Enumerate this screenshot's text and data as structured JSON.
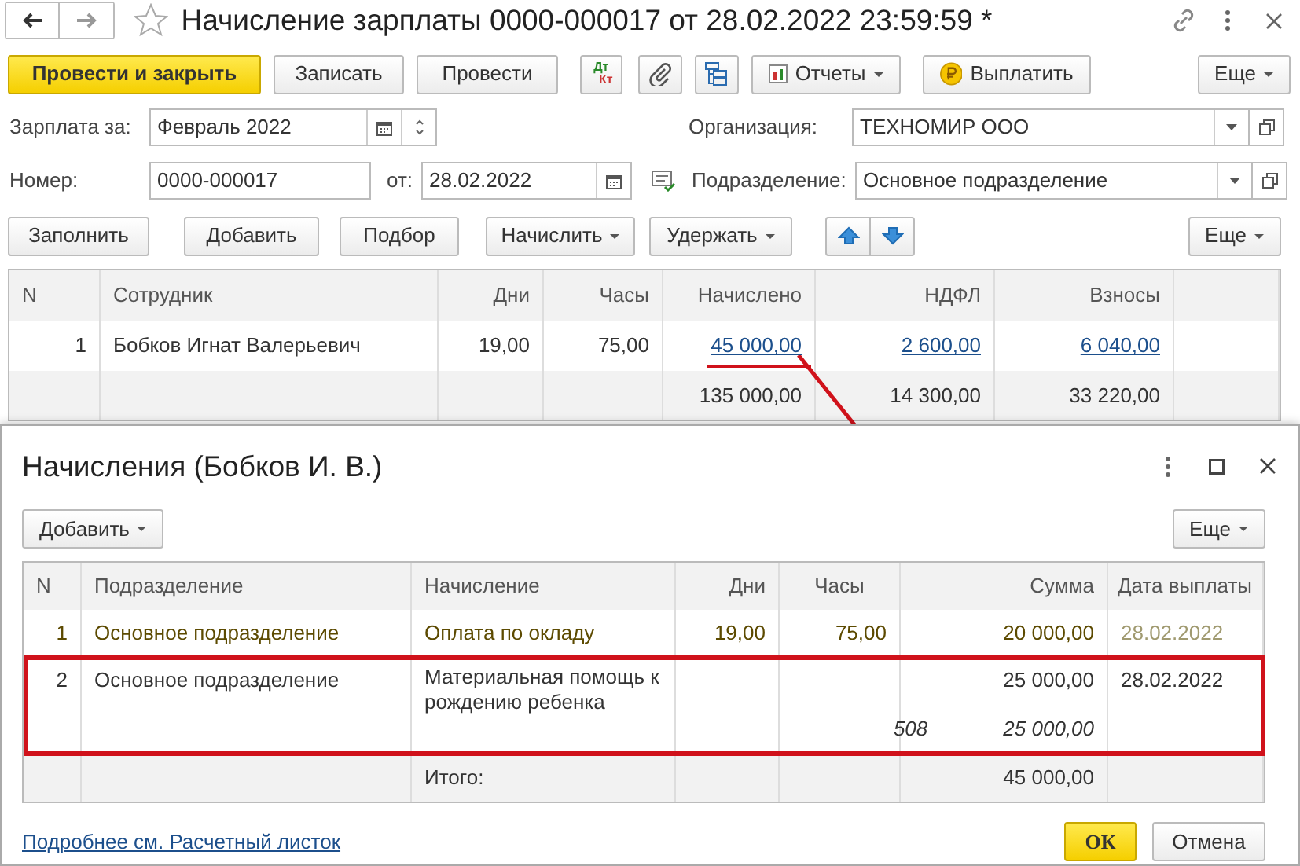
{
  "window": {
    "title": "Начисление зарплаты 0000-000017 от 28.02.2022 23:59:59 *"
  },
  "toolbar": [
    {
      "kind": "primary",
      "label": "Провести и закрыть"
    },
    {
      "kind": "button",
      "label": "Записать"
    },
    {
      "kind": "button",
      "label": "Провести"
    },
    {
      "kind": "dtkt",
      "top": "Дт",
      "bottom": "Кт"
    },
    {
      "kind": "clip"
    },
    {
      "kind": "structure"
    },
    {
      "kind": "reports",
      "label": "Отчеты"
    },
    {
      "kind": "pay",
      "label": "Выплатить"
    },
    {
      "kind": "more",
      "label": "Еще"
    }
  ],
  "fields": [
    {
      "kind": "period",
      "label": "Зарплата за:",
      "value": "Февраль 2022"
    },
    {
      "kind": "select",
      "label": "Организация:",
      "value": "ТЕХНОМИР ООО"
    },
    {
      "kind": "text",
      "label": "Номер:",
      "value": "0000-000017"
    },
    {
      "kind": "date",
      "label": "от:",
      "value": "28.02.2022"
    },
    {
      "kind": "select",
      "label": "Подразделение:",
      "value": "Основное подразделение"
    }
  ],
  "table_toolbar": [
    {
      "kind": "button",
      "label": "Заполнить"
    },
    {
      "kind": "button",
      "label": "Добавить"
    },
    {
      "kind": "button",
      "label": "Подбор"
    },
    {
      "kind": "menu",
      "label": "Начислить"
    },
    {
      "kind": "menu",
      "label": "Удержать"
    },
    {
      "kind": "up"
    },
    {
      "kind": "down"
    },
    {
      "kind": "more",
      "label": "Еще"
    }
  ],
  "table": {
    "columns": [
      "N",
      "Сотрудник",
      "Дни",
      "Часы",
      "Начислено",
      "НДФЛ",
      "Взносы"
    ],
    "rows": [
      {
        "n": "1",
        "employee": "Бобков Игнат Валерьевич",
        "days": "19,00",
        "hours": "75,00",
        "accrued": "45 000,00",
        "callout": true,
        "ndfl": "2 600,00",
        "contributions": "6 040,00"
      }
    ],
    "totals": {
      "accrued": "135 000,00",
      "ndfl": "14 300,00",
      "contributions": "33 220,00"
    }
  },
  "dialog": {
    "title": "Начисления (Бобков И. В.)",
    "add_button": "Добавить",
    "more_button": "Еще",
    "columns": [
      "N",
      "Подразделение",
      "Начисление",
      "Дни",
      "Часы",
      "Сумма",
      "Дата выплаты"
    ],
    "rows": [
      {
        "n": "1",
        "department": "Основное подразделение",
        "accrual": "Оплата по окладу",
        "days": "19,00",
        "hours": "75,00",
        "sum": "20 000,00",
        "date": "28.02.2022",
        "calculated": true,
        "highlighted": false
      },
      {
        "n": "2",
        "department": "Основное подразделение",
        "accrual": "Материальная помощь к рождению ребенка",
        "sum": "25 000,00",
        "date": "28.02.2022",
        "code": "508",
        "exempt": "25 000,00",
        "calculated": false,
        "highlighted": true
      }
    ],
    "total_label": "Итого:",
    "total_sum": "45 000,00",
    "link": "Подробнее см. Расчетный листок",
    "ok": "ОК",
    "cancel": "Отмена"
  }
}
